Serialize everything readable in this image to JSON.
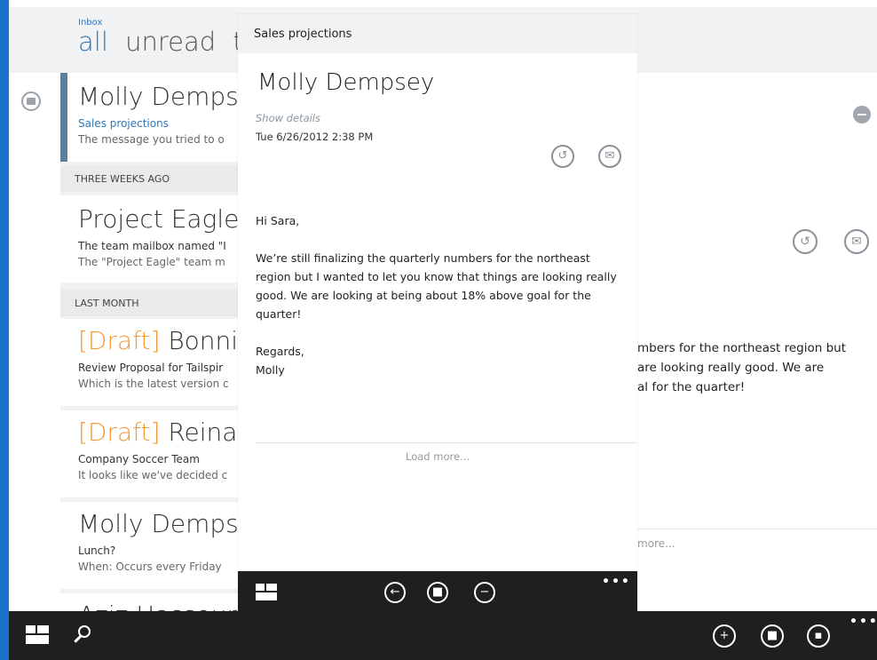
{
  "header": {
    "inbox_label": "Inbox",
    "pivots": [
      "all",
      "unread",
      "t"
    ]
  },
  "list": {
    "groups": [
      "THREE WEEKS AGO",
      "LAST MONTH"
    ],
    "messages": [
      {
        "from": "Molly Demps",
        "draft": "",
        "subject": "Sales projections",
        "preview": "The message you tried to o",
        "selected": true
      },
      {
        "from": "Project Eagle",
        "draft": "",
        "subject": "The team mailbox named \"I",
        "preview": "The \"Project Eagle\" team m",
        "selected": false
      },
      {
        "from": "Bonnie",
        "draft": "[Draft]",
        "subject": "Review Proposal for Tailspir",
        "preview": "Which is the latest version c",
        "selected": false
      },
      {
        "from": "Reina",
        "draft": "[Draft]",
        "subject": "Company Soccer Team",
        "preview": "It looks like we've decided c",
        "selected": false
      },
      {
        "from": "Molly Demps",
        "draft": "",
        "subject": "Lunch?",
        "preview": "When: Occurs every Friday",
        "selected": false
      },
      {
        "from": "Aziz Hassour",
        "draft": "",
        "subject": "",
        "preview": "",
        "selected": false
      }
    ]
  },
  "background_pane": {
    "body_lines": [
      "mbers for the northeast region but",
      " are looking really good.  We are",
      "al for the quarter!"
    ],
    "load_more": "more..."
  },
  "overlay": {
    "title": "Sales projections",
    "sender": "Molly Dempsey",
    "show_details": "Show details",
    "date": "Tue 6/26/2012 2:38 PM",
    "greeting": "Hi Sara,",
    "body": "We’re still finalizing the quarterly numbers for the northeast region but I wanted to let you know that things are looking really good.  We are looking at being about 18% above goal for the quarter!",
    "closing": "Regards,",
    "signature": "Molly",
    "load_more": "Load more..."
  },
  "icons": {
    "reply": "reply-all-icon",
    "open": "open-mail-icon",
    "back": "back-arrow-icon",
    "delete": "trash-icon",
    "remove": "minus-icon",
    "new": "plus-icon",
    "move": "move-to-folder-icon",
    "more": "ellipsis-icon"
  },
  "colors": {
    "accent": "#2f77b8",
    "draft": "#f39a31",
    "appbar": "#1f1f1f",
    "edge": "#1a73c8"
  }
}
